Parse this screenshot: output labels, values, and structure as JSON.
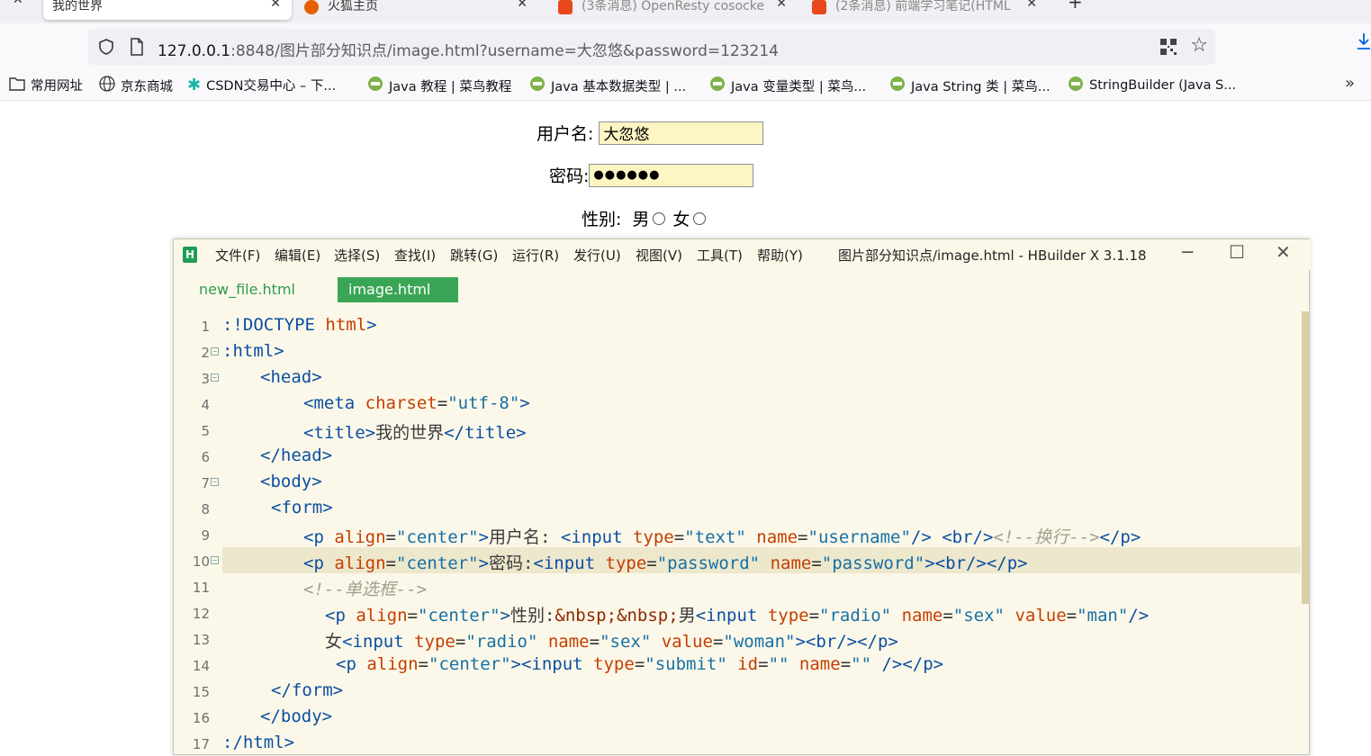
{
  "browser": {
    "tabs": [
      {
        "label": "我的世界",
        "active": true
      },
      {
        "label": "火狐主页",
        "active": false
      },
      {
        "label": "(3条消息) OpenResty cosocke",
        "active": false
      },
      {
        "label": "(2条消息) 前端学习笔记(HTML",
        "active": false
      }
    ],
    "url_host": "127.0.0.1",
    "url_path": ":8848/图片部分知识点/image.html?username=大忽悠&password=123214",
    "bookmarks": [
      "常用网址",
      "京东商城",
      "CSDN交易中心 – 下...",
      "Java 教程 | 菜鸟教程",
      "Java 基本数据类型 | ...",
      "Java 变量类型 | 菜鸟...",
      "Java String 类 | 菜鸟...",
      "StringBuilder (Java S..."
    ]
  },
  "form": {
    "username_label": "用户名:",
    "username_value": "大忽悠",
    "password_label": "密码:",
    "password_value": "●●●●●●",
    "sex_label": "性别:",
    "male": "男",
    "female": "女"
  },
  "hbuilder": {
    "menu": [
      "文件(F)",
      "编辑(E)",
      "选择(S)",
      "查找(I)",
      "跳转(G)",
      "运行(R)",
      "发行(U)",
      "视图(V)",
      "工具(T)",
      "帮助(Y)"
    ],
    "window_title": "图片部分知识点/image.html - HBuilder X 3.1.18",
    "tabs": [
      "new_file.html",
      "image.html"
    ],
    "line_numbers": [
      "1",
      "2",
      "3",
      "4",
      "5",
      "6",
      "7",
      "8",
      "9",
      "10",
      "11",
      "12",
      "13",
      "14",
      "15",
      "16",
      "17"
    ]
  },
  "colors": {
    "editor_bg": "#fcf8e9",
    "active_tab": "#3aa655",
    "autofill": "#fdf5c2"
  }
}
